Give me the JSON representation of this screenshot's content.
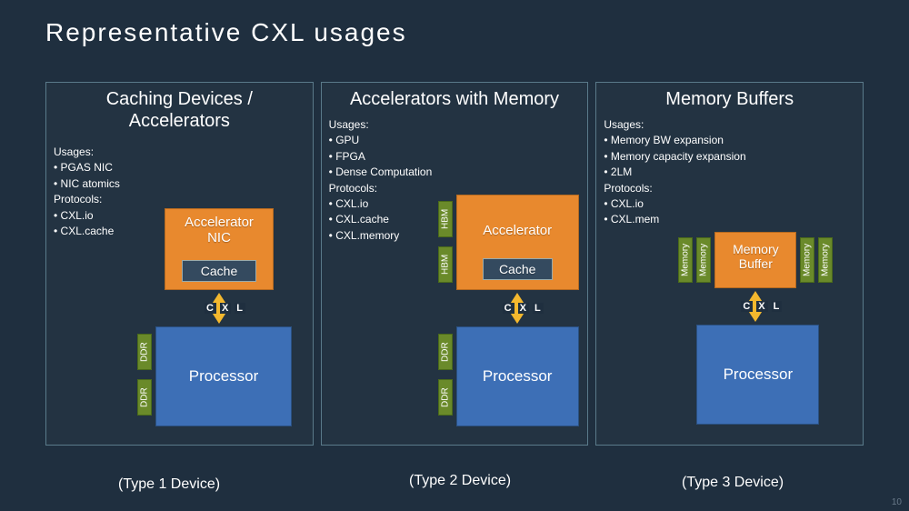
{
  "title": "Representative  CXL  usages",
  "page_number": "10",
  "cxl_label": {
    "c": "C",
    "x": "X",
    "l": "L"
  },
  "common": {
    "processor": "Processor",
    "cache": "Cache",
    "ddr": "DDR",
    "hbm": "HBM",
    "memory": "Memory"
  },
  "panels": [
    {
      "title_line1": "Caching  Devices /",
      "title_line2": "Accelerators",
      "usages_hdr": "Usages:",
      "usages": [
        "PGAS NIC",
        "NIC atomics"
      ],
      "protocols_hdr": "Protocols:",
      "protocols": [
        "CXL.io",
        "CXL.cache"
      ],
      "device_label_line1": "Accelerator",
      "device_label_line2": "NIC",
      "caption": "(Type 1 Device)"
    },
    {
      "title_line1": "Accelerators  with  Memory",
      "usages_hdr": "Usages:",
      "usages": [
        "GPU",
        "FPGA",
        "Dense Computation"
      ],
      "protocols_hdr": "Protocols:",
      "protocols": [
        "CXL.io",
        "CXL.cache",
        "CXL.memory"
      ],
      "device_label_line1": "Accelerator",
      "caption": "(Type 2 Device)"
    },
    {
      "title_line1": "Memory  Buffers",
      "usages_hdr": "Usages:",
      "usages": [
        "Memory BW expansion",
        "Memory capacity expansion",
        "2LM"
      ],
      "protocols_hdr": "Protocols:",
      "protocols": [
        "CXL.io",
        "CXL.mem"
      ],
      "device_label_line1": "Memory",
      "device_label_line2": "Buffer",
      "caption": "(Type 3 Device)"
    }
  ]
}
